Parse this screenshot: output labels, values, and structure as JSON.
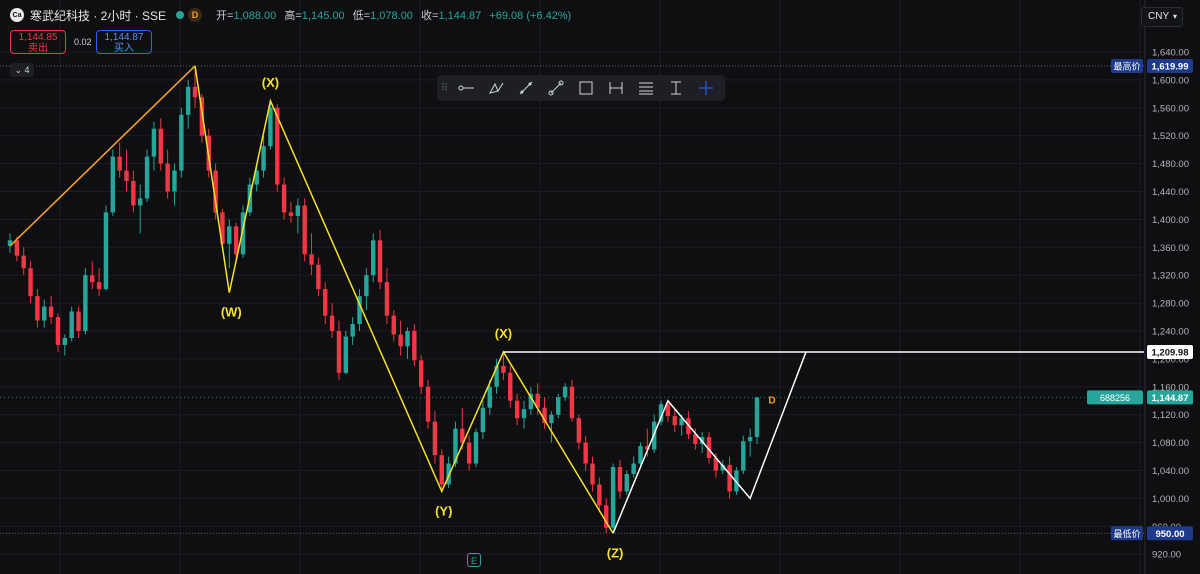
{
  "header": {
    "logo_text": "Ca",
    "symbol_title": "寒武纪科技 · 2小时 · SSE",
    "badge": "D",
    "open_label": "开=",
    "open_value": "1,088.00",
    "high_label": "高=",
    "high_value": "1,145.00",
    "low_label": "低=",
    "low_value": "1,078.00",
    "close_label": "收=",
    "close_value": "1,144.87",
    "change_value": "+69.08 (+6.42%)"
  },
  "trade": {
    "sell_price": "1,144.85",
    "sell_label": "卖出",
    "spread": "0.02",
    "buy_price": "1,144.87",
    "buy_label": "买入"
  },
  "layers_count": "4",
  "currency": "CNY",
  "toolbar_icons": [
    "horizontal-ray-icon",
    "brush-icon",
    "trend-line-icon",
    "segment-icon",
    "rectangle-icon",
    "date-range-icon",
    "fib-retracement-icon",
    "price-range-icon",
    "crosshair-icon"
  ],
  "event_marker": "E",
  "colors": {
    "up": "#26a69a",
    "down": "#f23645",
    "wave_yellow": "#f5e12a",
    "wave_orange": "#f0a020",
    "accent_blue": "#2962ff"
  },
  "chart_data": {
    "type": "candlestick",
    "y_axis": {
      "ticks": [
        "1,640.00",
        "1,600.00",
        "1,560.00",
        "1,520.00",
        "1,480.00",
        "1,440.00",
        "1,400.00",
        "1,360.00",
        "1,320.00",
        "1,280.00",
        "1,240.00",
        "1,200.00",
        "1,160.00",
        "1,120.00",
        "1,080.00",
        "1,040.00",
        "1,000.00",
        "960.00",
        "920.00"
      ],
      "tick_values": [
        1640,
        1600,
        1560,
        1520,
        1480,
        1440,
        1400,
        1360,
        1320,
        1280,
        1240,
        1200,
        1160,
        1120,
        1080,
        1040,
        1000,
        960,
        920
      ]
    },
    "price_labels": [
      {
        "text": "最高价",
        "value_text": "1,619.99",
        "value": 1619.99
      },
      {
        "text": "",
        "value_text": "1,209.98",
        "value": 1209.98
      },
      {
        "text": "688256",
        "value_text": "1,144.87",
        "value": 1144.87
      },
      {
        "text": "最低价",
        "value_text": "950.00",
        "value": 950.0
      }
    ],
    "candles": [
      [
        1362,
        1380,
        1352,
        1370
      ],
      [
        1370,
        1375,
        1340,
        1348
      ],
      [
        1348,
        1360,
        1320,
        1330
      ],
      [
        1330,
        1340,
        1280,
        1290
      ],
      [
        1290,
        1300,
        1245,
        1255
      ],
      [
        1255,
        1285,
        1245,
        1275
      ],
      [
        1275,
        1290,
        1250,
        1260
      ],
      [
        1260,
        1265,
        1210,
        1220
      ],
      [
        1220,
        1235,
        1205,
        1230
      ],
      [
        1230,
        1275,
        1225,
        1268
      ],
      [
        1268,
        1275,
        1230,
        1240
      ],
      [
        1240,
        1330,
        1235,
        1320
      ],
      [
        1320,
        1340,
        1300,
        1310
      ],
      [
        1310,
        1330,
        1290,
        1300
      ],
      [
        1300,
        1420,
        1298,
        1410
      ],
      [
        1410,
        1500,
        1405,
        1490
      ],
      [
        1490,
        1510,
        1460,
        1470
      ],
      [
        1470,
        1500,
        1440,
        1455
      ],
      [
        1455,
        1470,
        1410,
        1420
      ],
      [
        1420,
        1450,
        1380,
        1430
      ],
      [
        1430,
        1500,
        1425,
        1490
      ],
      [
        1490,
        1540,
        1470,
        1530
      ],
      [
        1530,
        1545,
        1470,
        1480
      ],
      [
        1480,
        1500,
        1430,
        1440
      ],
      [
        1440,
        1480,
        1420,
        1470
      ],
      [
        1470,
        1560,
        1460,
        1550
      ],
      [
        1550,
        1600,
        1530,
        1590
      ],
      [
        1590,
        1619.99,
        1560,
        1575
      ],
      [
        1575,
        1580,
        1510,
        1520
      ],
      [
        1520,
        1530,
        1460,
        1470
      ],
      [
        1470,
        1480,
        1400,
        1410
      ],
      [
        1410,
        1415,
        1360,
        1365
      ],
      [
        1365,
        1400,
        1330,
        1390
      ],
      [
        1390,
        1395,
        1340,
        1350
      ],
      [
        1350,
        1420,
        1345,
        1410
      ],
      [
        1410,
        1460,
        1405,
        1450
      ],
      [
        1450,
        1480,
        1440,
        1470
      ],
      [
        1470,
        1520,
        1460,
        1505
      ],
      [
        1505,
        1570,
        1500,
        1560
      ],
      [
        1560,
        1565,
        1440,
        1450
      ],
      [
        1450,
        1460,
        1400,
        1410
      ],
      [
        1410,
        1425,
        1395,
        1405
      ],
      [
        1405,
        1430,
        1380,
        1420
      ],
      [
        1420,
        1430,
        1340,
        1350
      ],
      [
        1350,
        1380,
        1320,
        1335
      ],
      [
        1335,
        1345,
        1290,
        1300
      ],
      [
        1300,
        1310,
        1250,
        1262
      ],
      [
        1262,
        1280,
        1230,
        1240
      ],
      [
        1240,
        1255,
        1170,
        1180
      ],
      [
        1180,
        1240,
        1178,
        1232
      ],
      [
        1232,
        1260,
        1220,
        1250
      ],
      [
        1250,
        1300,
        1240,
        1290
      ],
      [
        1290,
        1330,
        1270,
        1320
      ],
      [
        1320,
        1380,
        1310,
        1370
      ],
      [
        1370,
        1385,
        1300,
        1310
      ],
      [
        1310,
        1330,
        1250,
        1262
      ],
      [
        1262,
        1270,
        1225,
        1235
      ],
      [
        1235,
        1255,
        1205,
        1218
      ],
      [
        1218,
        1245,
        1200,
        1240
      ],
      [
        1240,
        1250,
        1190,
        1198
      ],
      [
        1198,
        1205,
        1150,
        1160
      ],
      [
        1160,
        1170,
        1100,
        1110
      ],
      [
        1110,
        1125,
        1050,
        1062
      ],
      [
        1062,
        1070,
        1010,
        1020
      ],
      [
        1020,
        1060,
        1015,
        1050
      ],
      [
        1050,
        1110,
        1045,
        1100
      ],
      [
        1100,
        1130,
        1070,
        1080
      ],
      [
        1080,
        1090,
        1040,
        1050
      ],
      [
        1050,
        1100,
        1045,
        1095
      ],
      [
        1095,
        1140,
        1085,
        1130
      ],
      [
        1130,
        1170,
        1120,
        1160
      ],
      [
        1160,
        1200,
        1150,
        1190
      ],
      [
        1190,
        1209.98,
        1170,
        1180
      ],
      [
        1180,
        1190,
        1130,
        1140
      ],
      [
        1140,
        1150,
        1105,
        1115
      ],
      [
        1115,
        1140,
        1100,
        1128
      ],
      [
        1128,
        1160,
        1120,
        1150
      ],
      [
        1150,
        1165,
        1120,
        1130
      ],
      [
        1130,
        1145,
        1100,
        1108
      ],
      [
        1108,
        1125,
        1080,
        1120
      ],
      [
        1120,
        1150,
        1115,
        1145
      ],
      [
        1145,
        1165,
        1140,
        1160
      ],
      [
        1160,
        1170,
        1110,
        1115
      ],
      [
        1115,
        1120,
        1070,
        1080
      ],
      [
        1080,
        1090,
        1040,
        1050
      ],
      [
        1050,
        1060,
        1010,
        1020
      ],
      [
        1020,
        1030,
        980,
        990
      ],
      [
        990,
        1000,
        950,
        958
      ],
      [
        958,
        1050,
        955,
        1045
      ],
      [
        1045,
        1055,
        1000,
        1010
      ],
      [
        1010,
        1040,
        1005,
        1035
      ],
      [
        1035,
        1060,
        1030,
        1050
      ],
      [
        1050,
        1080,
        1045,
        1075
      ],
      [
        1075,
        1100,
        1060,
        1070
      ],
      [
        1070,
        1120,
        1065,
        1110
      ],
      [
        1110,
        1140,
        1105,
        1135
      ],
      [
        1135,
        1140,
        1110,
        1118
      ],
      [
        1118,
        1130,
        1095,
        1105
      ],
      [
        1105,
        1120,
        1090,
        1115
      ],
      [
        1115,
        1125,
        1085,
        1092
      ],
      [
        1092,
        1100,
        1070,
        1078
      ],
      [
        1078,
        1095,
        1065,
        1088
      ],
      [
        1088,
        1095,
        1050,
        1058
      ],
      [
        1058,
        1065,
        1030,
        1040
      ],
      [
        1040,
        1055,
        1035,
        1048
      ],
      [
        1048,
        1060,
        1000,
        1010
      ],
      [
        1010,
        1045,
        1005,
        1040
      ],
      [
        1040,
        1090,
        1035,
        1082
      ],
      [
        1082,
        1100,
        1060,
        1088
      ],
      [
        1088,
        1145,
        1078,
        1144.87
      ]
    ],
    "wave_labels": [
      "(X)",
      "(W)",
      "(X)",
      "(Y)",
      "(Z)"
    ],
    "annotations": {
      "horizontal_line_value": 1209.98
    }
  }
}
